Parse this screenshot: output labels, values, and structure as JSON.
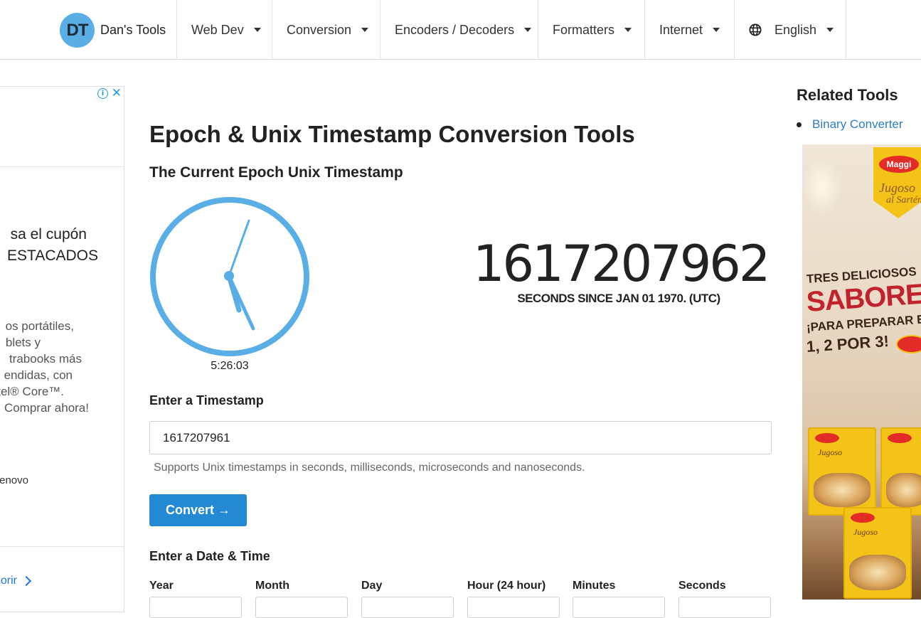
{
  "navbar": {
    "logo_text": "DT",
    "brand": "Dan's Tools",
    "items": [
      {
        "label": "Web Dev"
      },
      {
        "label": "Conversion"
      },
      {
        "label": "Encoders / Decoders"
      },
      {
        "label": "Formatters"
      },
      {
        "label": "Internet"
      },
      {
        "label": "English",
        "icon": "globe-icon"
      }
    ]
  },
  "left_ad": {
    "info_icon": "i",
    "close_icon": "✕",
    "headline": [
      "sa el cupón",
      "ESTACADOS"
    ],
    "body": [
      "os portátiles,",
      "blets y",
      "trabooks más",
      "endidas, con",
      "tel® Core™.",
      "Comprar ahora!"
    ],
    "brand": "enovo",
    "cta": "orir"
  },
  "main": {
    "title": "Epoch & Unix Timestamp Conversion Tools",
    "subtitle": "The Current Epoch Unix Timestamp",
    "clock_time": "5:26:03",
    "current_timestamp": "1617207962",
    "timestamp_caption": "SECONDS SINCE JAN 01 1970. (UTC)",
    "enter_timestamp_label": "Enter a Timestamp",
    "timestamp_input_value": "1617207961",
    "help_text": "Supports Unix timestamps in seconds, milliseconds, microseconds and nanoseconds.",
    "convert_button": "Convert →",
    "enter_datetime_label": "Enter a Date & Time",
    "datetime_columns": [
      "Year",
      "Month",
      "Day",
      "Hour (24 hour)",
      "Minutes",
      "Seconds"
    ]
  },
  "sidebar": {
    "title": "Related Tools",
    "links": [
      "Binary Converter"
    ]
  },
  "right_ad": {
    "logo": "Maggi",
    "tagline": [
      "Jugoso",
      "al Sartén"
    ],
    "line1": "TRES DELICIOSOS",
    "line2": "SABORES",
    "line3": "¡PARA PREPARAR E",
    "line4": "1, 2 POR 3!",
    "pack_title": "Jugoso"
  },
  "colors": {
    "accent": "#2489d3",
    "clock": "#5aaee6",
    "link": "#2a7fc5"
  }
}
